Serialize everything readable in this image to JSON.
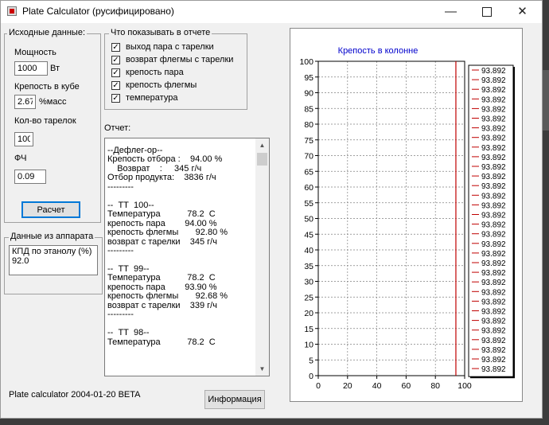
{
  "window": {
    "title": "Plate Calculator (русифицировано)"
  },
  "inputs": {
    "legend": "Исходные данные:",
    "power": {
      "label": "Мощность",
      "value": "1000",
      "unit": "Вт"
    },
    "strength": {
      "label": "Крепость в кубе",
      "value": "2.67",
      "unit": "%масс"
    },
    "plates": {
      "label": "Кол-во тарелок",
      "value": "100"
    },
    "fc": {
      "label": "ФЧ",
      "value": "0.09"
    },
    "calc_label": "Расчет"
  },
  "show": {
    "legend": "Что показывать в отчете",
    "items": [
      {
        "label": "выход пара с тарелки",
        "checked": true
      },
      {
        "label": "возврат флегмы с тарелки",
        "checked": true
      },
      {
        "label": "крепость пара",
        "checked": true
      },
      {
        "label": "крепость флегмы",
        "checked": true
      },
      {
        "label": "температура",
        "checked": true
      }
    ]
  },
  "device": {
    "legend": "Данные из аппарата",
    "lines": [
      "КПД по этанолу (%)",
      "92.0"
    ]
  },
  "report": {
    "label": "Отчет:",
    "lines": [
      "--Дефлег-ор--",
      "Крепость отбора :    94.00 %",
      "    Возврат    :     345 г/ч",
      "Отбор продукта:    3836 г/ч",
      "---------",
      "",
      "--  ТТ  100--",
      "Температура           78.2  C",
      "крепость пара        94.00 %",
      "крепость флегмы       92.80 %",
      "возврат с тарелки    345 г/ч",
      "---------",
      "",
      "--  ТТ  99--",
      "Температура           78.2  C",
      "крепость пара        93.90 %",
      "крепость флегмы       92.68 %",
      "возврат с тарелки    339 г/ч",
      "---------",
      "",
      "--  ТТ  98--",
      "Температура           78.2  C"
    ]
  },
  "footer": {
    "version": "Plate calculator 2004-01-20 BETA",
    "info_label": "Информация"
  },
  "colors": {
    "series": "#c00000",
    "title": "#0000cc",
    "grid": "#808080"
  },
  "chart_data": {
    "type": "line",
    "title": "Крепость в колонне",
    "xlabel": "",
    "ylabel": "",
    "xlim": [
      0,
      100
    ],
    "ylim": [
      0,
      100
    ],
    "x_ticks": [
      "0",
      "20",
      "40",
      "60",
      "80",
      "100"
    ],
    "y_ticks": [
      "0",
      "5",
      "10",
      "15",
      "20",
      "25",
      "30",
      "35",
      "40",
      "45",
      "50",
      "55",
      "60",
      "65",
      "70",
      "75",
      "80",
      "85",
      "90",
      "95",
      "100"
    ],
    "grid": true,
    "legend_position": "right",
    "series": [
      {
        "x": [
          94,
          94
        ],
        "y": [
          0,
          100
        ]
      }
    ],
    "legend": [
      "93.892",
      "93.892",
      "93.892",
      "93.892",
      "93.892",
      "93.892",
      "93.892",
      "93.892",
      "93.892",
      "93.892",
      "93.892",
      "93.892",
      "93.892",
      "93.892",
      "93.892",
      "93.892",
      "93.892",
      "93.892",
      "93.892",
      "93.892",
      "93.892",
      "93.892",
      "93.892",
      "93.892",
      "93.892",
      "93.892",
      "93.892",
      "93.892",
      "93.892",
      "93.892",
      "93.892",
      "93.892"
    ]
  }
}
